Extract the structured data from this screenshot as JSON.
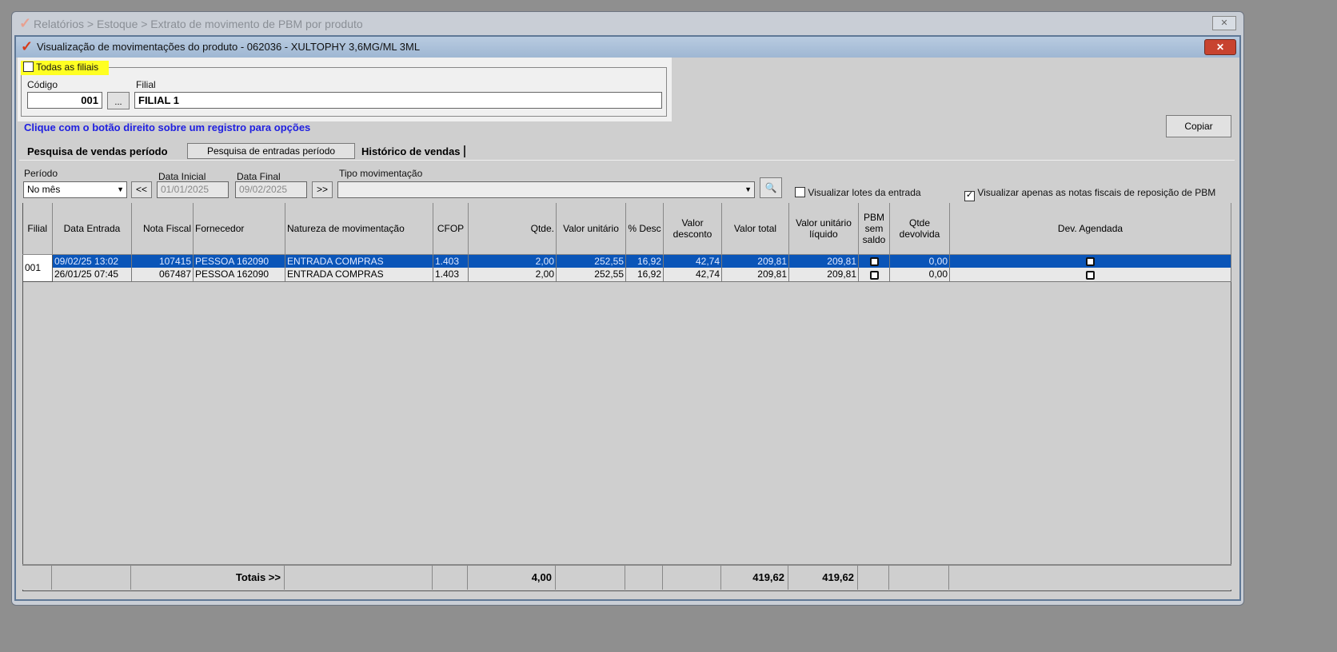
{
  "outer_window": {
    "title": "Relatórios > Estoque > Extrato de movimento de PBM por produto",
    "close": "✕"
  },
  "window": {
    "title": "Visualização de movimentações do produto - 062036 - XULTOPHY 3,6MG/ML 3ML",
    "close": "✕"
  },
  "filter": {
    "all_branches_label": "Todas as filiais",
    "all_branches_checked": false,
    "code_label": "Código",
    "code_value": "001",
    "lookup_label": "...",
    "branch_label": "Filial",
    "branch_value": "FILIAL 1"
  },
  "hint": "Clique com o botão direito sobre um registro para opções",
  "copy_button": "Copiar",
  "tabs": [
    {
      "label": "Pesquisa de vendas período"
    },
    {
      "label": "Pesquisa de entradas período"
    },
    {
      "label": "Histórico de vendas"
    }
  ],
  "search": {
    "period_label": "Período",
    "period_value": "No mês",
    "prev": "<<",
    "start_label": "Data Inicial",
    "start_value": "01/01/2025",
    "end_label": "Data Final",
    "end_value": "09/02/2025",
    "next": ">>",
    "type_label": "Tipo movimentação",
    "type_value": "",
    "lots_label": "Visualizar lotes da entrada",
    "lots_checked": false,
    "pbm_only_label": "Visualizar apenas as notas fiscais de reposição de PBM",
    "pbm_only_checked": true
  },
  "table": {
    "columns": [
      "Filial",
      "Data Entrada",
      "Nota Fiscal",
      "Fornecedor",
      "Natureza de movimentação",
      "CFOP",
      "Qtde.",
      "Valor unitário",
      "% Desc",
      "Valor desconto",
      "Valor total",
      "Valor unitário líquido",
      "PBM sem saldo",
      "Qtde devolvida",
      "Dev. Agendada"
    ],
    "branch": "001",
    "rows": [
      {
        "data": "09/02/25 13:02",
        "nf": "107415",
        "fornecedor": "PESSOA 162090",
        "natureza": "ENTRADA COMPRAS",
        "cfop": "1.403",
        "qtde": "2,00",
        "unit": "252,55",
        "desc": "16,92",
        "vdesc": "42,74",
        "total": "209,81",
        "liq": "209,81",
        "devolvida": "0,00"
      },
      {
        "data": "26/01/25 07:45",
        "nf": "067487",
        "fornecedor": "PESSOA 162090",
        "natureza": "ENTRADA COMPRAS",
        "cfop": "1.403",
        "qtde": "2,00",
        "unit": "252,55",
        "desc": "16,92",
        "vdesc": "42,74",
        "total": "209,81",
        "liq": "209,81",
        "devolvida": "0,00"
      }
    ],
    "totals": {
      "label": "Totais >>",
      "qtde": "4,00",
      "total": "419,62",
      "liq": "419,62"
    }
  }
}
